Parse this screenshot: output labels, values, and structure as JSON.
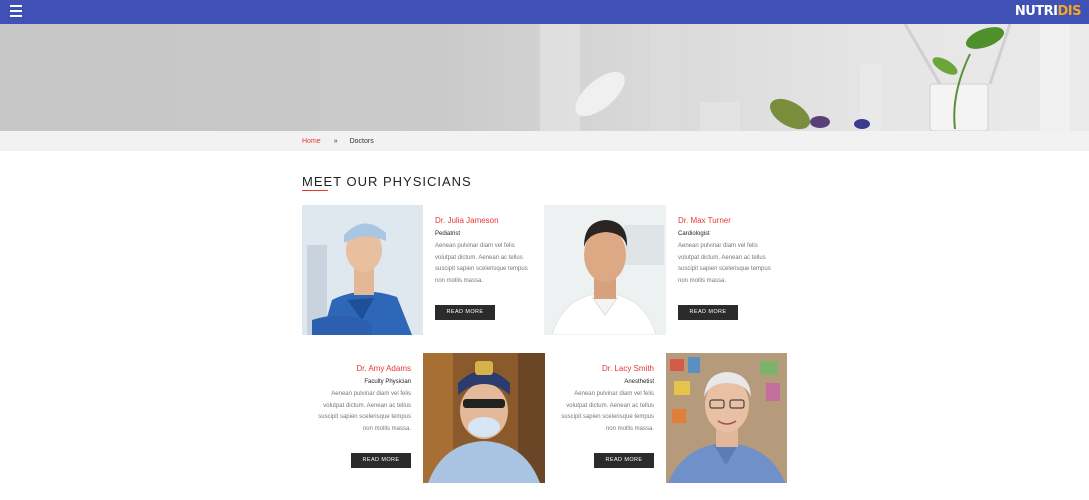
{
  "header": {
    "menu_icon": "hamburger-menu-icon",
    "logo_part1": "NUTRI",
    "logo_part2": "DIS",
    "colors": {
      "bar": "#3f51b5",
      "logo_accent": "#f5a623"
    }
  },
  "breadcrumb": {
    "home": "Home",
    "separator": "»",
    "current": "Doctors"
  },
  "section": {
    "title": "MEET OUR PHYSICIANS",
    "accent_color": "#e53935"
  },
  "doctors": [
    {
      "name": "Dr. Julia Jameson",
      "specialty": "Pediatrist",
      "bio": "Aenean pulvinar diam vel felis volutpat dictum. Aenean ac tellus suscipit sapien scelerisque tempus non mollis massa.",
      "button": "READ MORE"
    },
    {
      "name": "Dr. Max Turner",
      "specialty": "Cardiologist",
      "bio": "Aenean pulvinar diam vel felis volutpat dictum. Aenean ac tellus suscipit sapien scelerisque tempus non mollis massa.",
      "button": "READ MORE"
    },
    {
      "name": "Dr. Amy Adams",
      "specialty": "Faculty Physician",
      "bio": "Aenean pulvinar diam vel felis volutpat dictum. Aenean ac tellus suscipit sapien scelerisque tempus non mollis massa.",
      "button": "READ MORE"
    },
    {
      "name": "Dr. Lacy Smith",
      "specialty": "Anesthetist",
      "bio": "Aenean pulvinar diam vel felis volutpat dictum. Aenean ac tellus suscipit sapien scelerisque tempus non mollis massa.",
      "button": "READ MORE"
    }
  ]
}
